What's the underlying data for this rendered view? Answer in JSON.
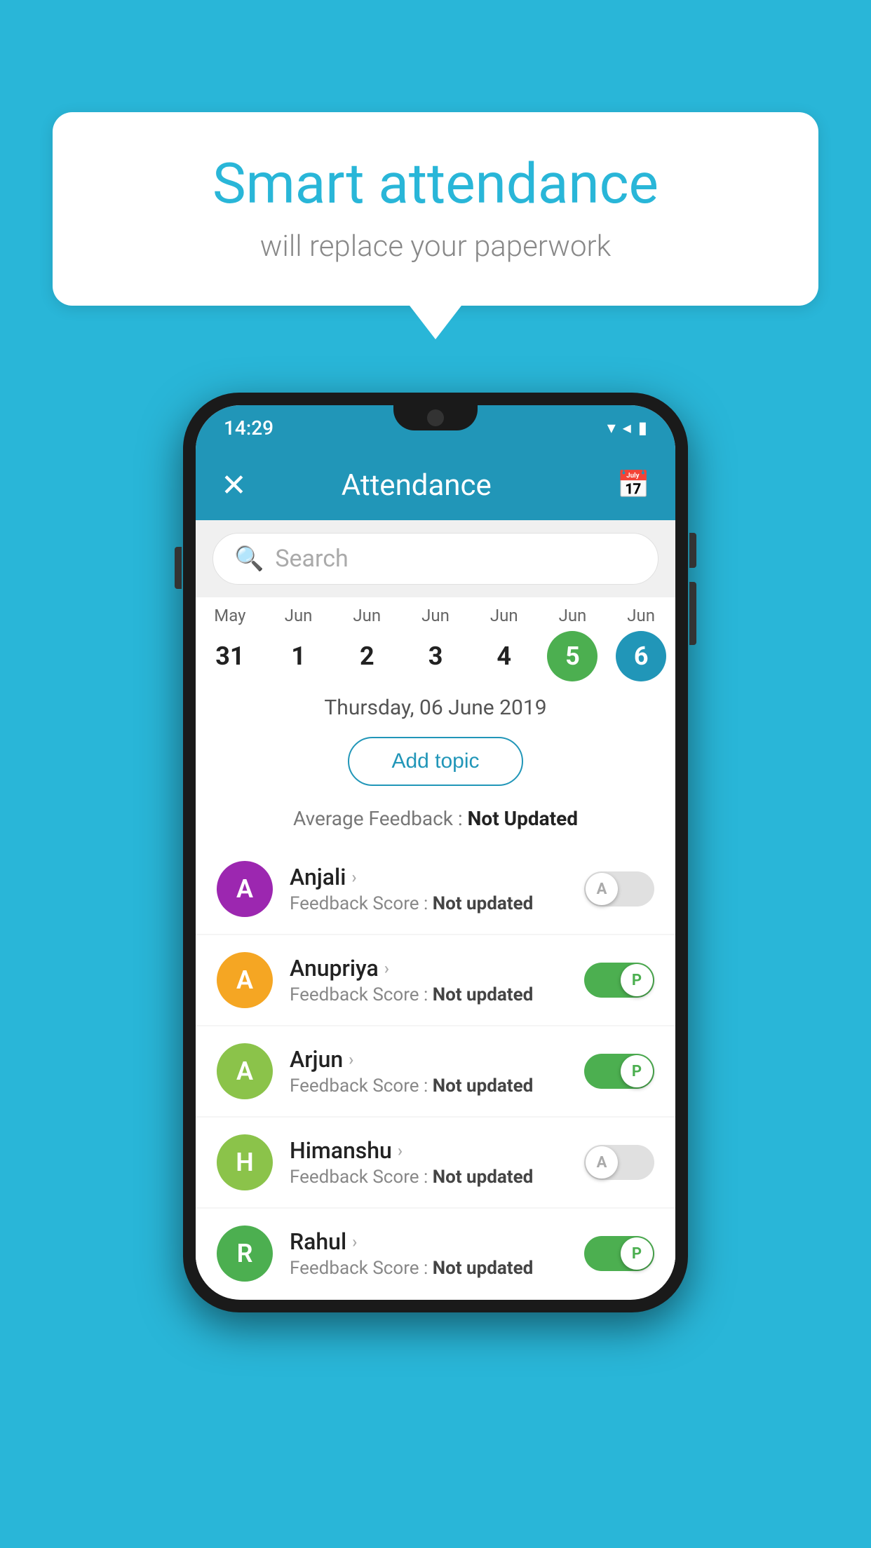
{
  "background": {
    "color": "#29b6d8"
  },
  "speech_bubble": {
    "title": "Smart attendance",
    "subtitle": "will replace your paperwork"
  },
  "phone": {
    "status_bar": {
      "time": "14:29",
      "icons": "▾ ◂ ▮"
    },
    "header": {
      "close_icon": "✕",
      "title": "Attendance",
      "calendar_icon": "📅"
    },
    "search": {
      "placeholder": "Search",
      "icon": "🔍"
    },
    "calendar": {
      "columns": [
        {
          "month": "May",
          "date": "31",
          "style": "normal"
        },
        {
          "month": "Jun",
          "date": "1",
          "style": "normal"
        },
        {
          "month": "Jun",
          "date": "2",
          "style": "normal"
        },
        {
          "month": "Jun",
          "date": "3",
          "style": "normal"
        },
        {
          "month": "Jun",
          "date": "4",
          "style": "normal"
        },
        {
          "month": "Jun",
          "date": "5",
          "style": "today"
        },
        {
          "month": "Jun",
          "date": "6",
          "style": "selected"
        }
      ]
    },
    "selected_date": "Thursday, 06 June 2019",
    "add_topic_label": "Add topic",
    "feedback_avg_label": "Average Feedback :",
    "feedback_avg_value": "Not Updated",
    "students": [
      {
        "name": "Anjali",
        "avatar_letter": "A",
        "avatar_color": "#9c27b0",
        "feedback_label": "Feedback Score :",
        "feedback_value": "Not updated",
        "toggle": "off",
        "toggle_letter": "A"
      },
      {
        "name": "Anupriya",
        "avatar_letter": "A",
        "avatar_color": "#f5a623",
        "feedback_label": "Feedback Score :",
        "feedback_value": "Not updated",
        "toggle": "on",
        "toggle_letter": "P"
      },
      {
        "name": "Arjun",
        "avatar_letter": "A",
        "avatar_color": "#8bc34a",
        "feedback_label": "Feedback Score :",
        "feedback_value": "Not updated",
        "toggle": "on",
        "toggle_letter": "P"
      },
      {
        "name": "Himanshu",
        "avatar_letter": "H",
        "avatar_color": "#8bc34a",
        "feedback_label": "Feedback Score :",
        "feedback_value": "Not updated",
        "toggle": "off",
        "toggle_letter": "A"
      },
      {
        "name": "Rahul",
        "avatar_letter": "R",
        "avatar_color": "#4caf50",
        "feedback_label": "Feedback Score :",
        "feedback_value": "Not updated",
        "toggle": "on",
        "toggle_letter": "P"
      }
    ]
  }
}
